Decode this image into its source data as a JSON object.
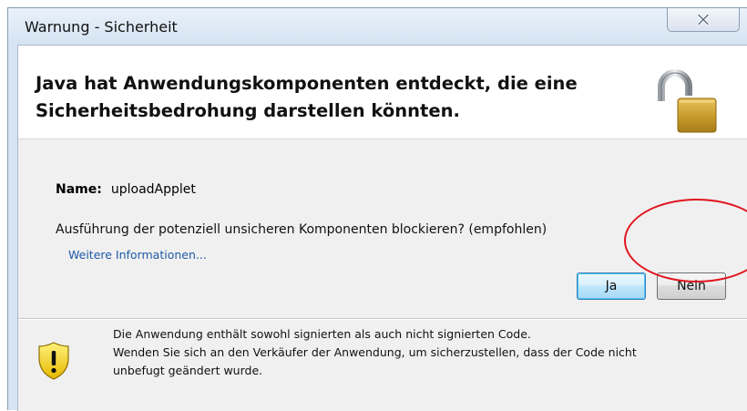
{
  "window": {
    "title": "Warnung - Sicherheit",
    "close_icon": "close-icon"
  },
  "header": {
    "message": "Java hat Anwendungskomponenten entdeckt, die eine Sicherheitsbedrohung darstellen könnten.",
    "icon": "unlocked-padlock-icon"
  },
  "details": {
    "name_label": "Name:",
    "name_value": "uploadApplet",
    "question": "Ausführung der potenziell unsicheren Komponenten blockieren? (empfohlen)",
    "more_info_link": "Weitere Informationen..."
  },
  "buttons": {
    "yes_label": "Ja",
    "no_label": "Nein"
  },
  "annotation": {
    "color": "#e0141e",
    "target": "no-button"
  },
  "footer": {
    "icon": "warning-shield-icon",
    "lines": [
      "Die Anwendung enthält sowohl signierten als auch nicht signierten Code.",
      "Wenden Sie sich an den Verkäufer der Anwendung, um sicherzustellen, dass der Code nicht",
      "unbefugt geändert wurde."
    ]
  },
  "colors": {
    "link": "#1e5aa8",
    "window_frame": "#d7e4f2",
    "default_button_border": "#3c7fb1"
  }
}
